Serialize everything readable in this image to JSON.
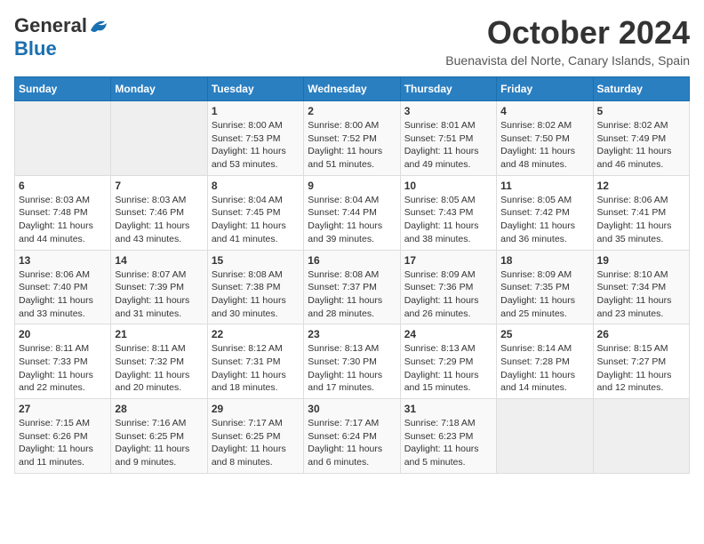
{
  "logo": {
    "general": "General",
    "blue": "Blue"
  },
  "header": {
    "month": "October 2024",
    "location": "Buenavista del Norte, Canary Islands, Spain"
  },
  "weekdays": [
    "Sunday",
    "Monday",
    "Tuesday",
    "Wednesday",
    "Thursday",
    "Friday",
    "Saturday"
  ],
  "weeks": [
    [
      {
        "day": "",
        "info": ""
      },
      {
        "day": "",
        "info": ""
      },
      {
        "day": "1",
        "info": "Sunrise: 8:00 AM\nSunset: 7:53 PM\nDaylight: 11 hours and 53 minutes."
      },
      {
        "day": "2",
        "info": "Sunrise: 8:00 AM\nSunset: 7:52 PM\nDaylight: 11 hours and 51 minutes."
      },
      {
        "day": "3",
        "info": "Sunrise: 8:01 AM\nSunset: 7:51 PM\nDaylight: 11 hours and 49 minutes."
      },
      {
        "day": "4",
        "info": "Sunrise: 8:02 AM\nSunset: 7:50 PM\nDaylight: 11 hours and 48 minutes."
      },
      {
        "day": "5",
        "info": "Sunrise: 8:02 AM\nSunset: 7:49 PM\nDaylight: 11 hours and 46 minutes."
      }
    ],
    [
      {
        "day": "6",
        "info": "Sunrise: 8:03 AM\nSunset: 7:48 PM\nDaylight: 11 hours and 44 minutes."
      },
      {
        "day": "7",
        "info": "Sunrise: 8:03 AM\nSunset: 7:46 PM\nDaylight: 11 hours and 43 minutes."
      },
      {
        "day": "8",
        "info": "Sunrise: 8:04 AM\nSunset: 7:45 PM\nDaylight: 11 hours and 41 minutes."
      },
      {
        "day": "9",
        "info": "Sunrise: 8:04 AM\nSunset: 7:44 PM\nDaylight: 11 hours and 39 minutes."
      },
      {
        "day": "10",
        "info": "Sunrise: 8:05 AM\nSunset: 7:43 PM\nDaylight: 11 hours and 38 minutes."
      },
      {
        "day": "11",
        "info": "Sunrise: 8:05 AM\nSunset: 7:42 PM\nDaylight: 11 hours and 36 minutes."
      },
      {
        "day": "12",
        "info": "Sunrise: 8:06 AM\nSunset: 7:41 PM\nDaylight: 11 hours and 35 minutes."
      }
    ],
    [
      {
        "day": "13",
        "info": "Sunrise: 8:06 AM\nSunset: 7:40 PM\nDaylight: 11 hours and 33 minutes."
      },
      {
        "day": "14",
        "info": "Sunrise: 8:07 AM\nSunset: 7:39 PM\nDaylight: 11 hours and 31 minutes."
      },
      {
        "day": "15",
        "info": "Sunrise: 8:08 AM\nSunset: 7:38 PM\nDaylight: 11 hours and 30 minutes."
      },
      {
        "day": "16",
        "info": "Sunrise: 8:08 AM\nSunset: 7:37 PM\nDaylight: 11 hours and 28 minutes."
      },
      {
        "day": "17",
        "info": "Sunrise: 8:09 AM\nSunset: 7:36 PM\nDaylight: 11 hours and 26 minutes."
      },
      {
        "day": "18",
        "info": "Sunrise: 8:09 AM\nSunset: 7:35 PM\nDaylight: 11 hours and 25 minutes."
      },
      {
        "day": "19",
        "info": "Sunrise: 8:10 AM\nSunset: 7:34 PM\nDaylight: 11 hours and 23 minutes."
      }
    ],
    [
      {
        "day": "20",
        "info": "Sunrise: 8:11 AM\nSunset: 7:33 PM\nDaylight: 11 hours and 22 minutes."
      },
      {
        "day": "21",
        "info": "Sunrise: 8:11 AM\nSunset: 7:32 PM\nDaylight: 11 hours and 20 minutes."
      },
      {
        "day": "22",
        "info": "Sunrise: 8:12 AM\nSunset: 7:31 PM\nDaylight: 11 hours and 18 minutes."
      },
      {
        "day": "23",
        "info": "Sunrise: 8:13 AM\nSunset: 7:30 PM\nDaylight: 11 hours and 17 minutes."
      },
      {
        "day": "24",
        "info": "Sunrise: 8:13 AM\nSunset: 7:29 PM\nDaylight: 11 hours and 15 minutes."
      },
      {
        "day": "25",
        "info": "Sunrise: 8:14 AM\nSunset: 7:28 PM\nDaylight: 11 hours and 14 minutes."
      },
      {
        "day": "26",
        "info": "Sunrise: 8:15 AM\nSunset: 7:27 PM\nDaylight: 11 hours and 12 minutes."
      }
    ],
    [
      {
        "day": "27",
        "info": "Sunrise: 7:15 AM\nSunset: 6:26 PM\nDaylight: 11 hours and 11 minutes."
      },
      {
        "day": "28",
        "info": "Sunrise: 7:16 AM\nSunset: 6:25 PM\nDaylight: 11 hours and 9 minutes."
      },
      {
        "day": "29",
        "info": "Sunrise: 7:17 AM\nSunset: 6:25 PM\nDaylight: 11 hours and 8 minutes."
      },
      {
        "day": "30",
        "info": "Sunrise: 7:17 AM\nSunset: 6:24 PM\nDaylight: 11 hours and 6 minutes."
      },
      {
        "day": "31",
        "info": "Sunrise: 7:18 AM\nSunset: 6:23 PM\nDaylight: 11 hours and 5 minutes."
      },
      {
        "day": "",
        "info": ""
      },
      {
        "day": "",
        "info": ""
      }
    ]
  ]
}
